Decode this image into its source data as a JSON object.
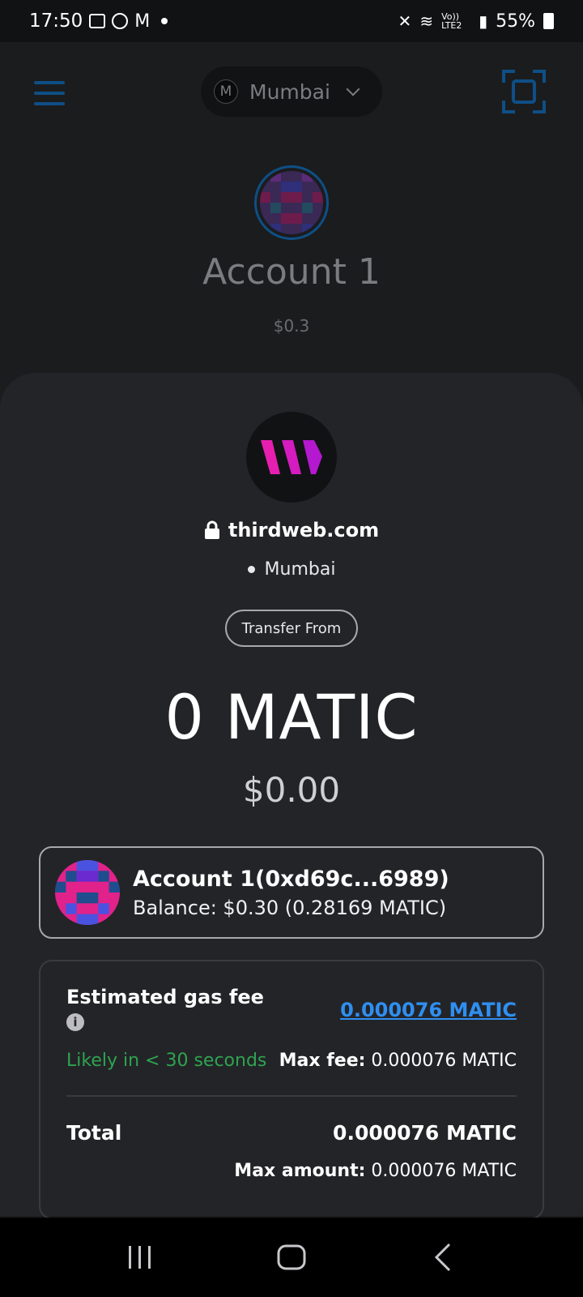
{
  "status_bar": {
    "time": "17:50",
    "battery": "55%",
    "network_text": "Vo)) LTE2"
  },
  "header": {
    "network_initial": "M",
    "network_name": "Mumbai"
  },
  "account": {
    "title": "Account 1",
    "balance": "$0.3"
  },
  "request": {
    "origin": "thirdweb.com",
    "network": "Mumbai",
    "method": "Transfer From",
    "amount": "0 MATIC",
    "fiat": "$0.00"
  },
  "from_account": {
    "name": "Account 1(0xd69c...6989)",
    "balance": "Balance: $0.30 (0.28169 MATIC)"
  },
  "gas": {
    "label": "Estimated gas fee",
    "info_glyph": "i",
    "value": "0.000076 MATIC",
    "likely": "Likely in < 30 seconds",
    "max_fee_label": "Max fee:",
    "max_fee_value": " 0.000076 MATIC",
    "total_label": "Total",
    "total_value": "0.000076 MATIC",
    "max_amount_label": "Max amount:",
    "max_amount_value": " 0.000076 MATIC"
  },
  "colors": {
    "accent_blue": "#2f8ff0",
    "dark_blue": "#0e4f86",
    "green": "#2ea44f",
    "sheet_bg": "#232428"
  },
  "icons": [
    "menu-icon",
    "scan-icon",
    "lock-icon",
    "info-icon",
    "recent-apps-icon",
    "home-icon",
    "back-icon"
  ]
}
